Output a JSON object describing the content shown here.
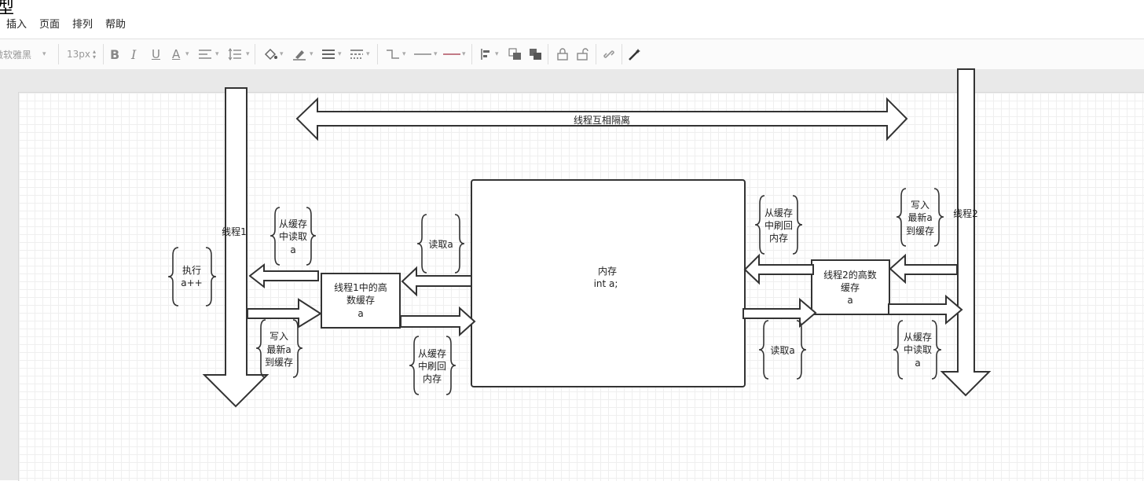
{
  "app": {
    "title": "型"
  },
  "menu": {
    "items": [
      "插入",
      "页面",
      "排列",
      "帮助"
    ]
  },
  "toolbar": {
    "font_family": "微软雅黑",
    "font_size": "13px",
    "bold": "B",
    "italic": "I",
    "underline": "U",
    "font_color": "A"
  },
  "diagram": {
    "isolation_label": "线程互相隔离",
    "thread1_label": "线程1",
    "thread2_label": "线程2",
    "memory": {
      "line1": "内存",
      "line2": "int a;"
    },
    "cache1": {
      "line1": "线程1中的高",
      "line2": "数缓存",
      "line3": "a"
    },
    "cache2": {
      "line1": "线程2的高数",
      "line2": "缓存",
      "line3": "a"
    },
    "exec": {
      "line1": "执行",
      "line2": "a++"
    },
    "t1_read_cache": {
      "line1": "从缓存",
      "line2": "中读取",
      "line3": "a"
    },
    "t1_write_cache": {
      "line1": "写入",
      "line2": "最新a",
      "line3": "到缓存"
    },
    "read_a_left": "读取a",
    "flush_left": {
      "line1": "从缓存",
      "line2": "中刷回",
      "line3": "内存"
    },
    "flush_right": {
      "line1": "从缓存",
      "line2": "中刷回",
      "line3": "内存"
    },
    "read_a_right": "读取a",
    "t2_write_cache": {
      "line1": "写入",
      "line2": "最新a",
      "line3": "到缓存"
    },
    "t2_read_cache": {
      "line1": "从缓存",
      "line2": "中读取",
      "line3": "a"
    }
  }
}
